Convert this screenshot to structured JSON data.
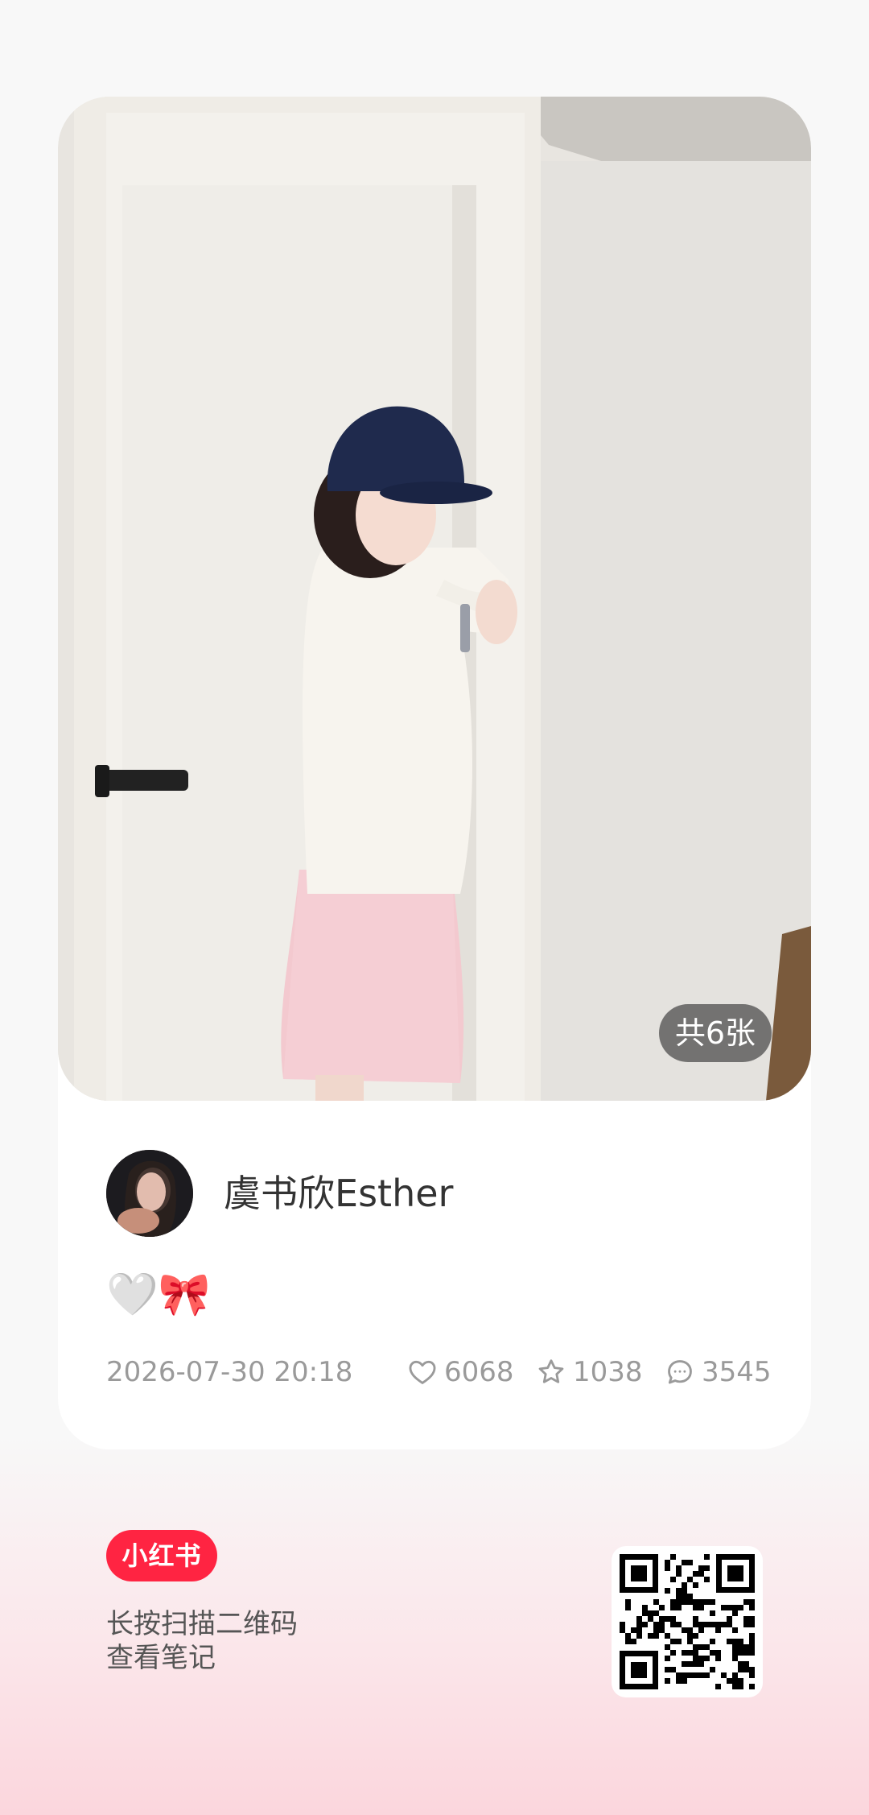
{
  "photo": {
    "image_count_label": "共6张"
  },
  "author": {
    "name": "虞书欣Esther"
  },
  "caption": "🤍🎀",
  "meta": {
    "date": "2026-07-30 20:18",
    "likes": "6068",
    "favorites": "1038",
    "comments": "3545"
  },
  "footer": {
    "brand": "小红书",
    "line1": "长按扫描二维码",
    "line2": "查看笔记"
  },
  "icons": {
    "like": "heart-icon",
    "favorite": "star-icon",
    "comment": "comment-icon"
  },
  "colors": {
    "brand": "#ff2442",
    "meta_text": "#9a9a9a",
    "badge_bg": "#464646"
  }
}
